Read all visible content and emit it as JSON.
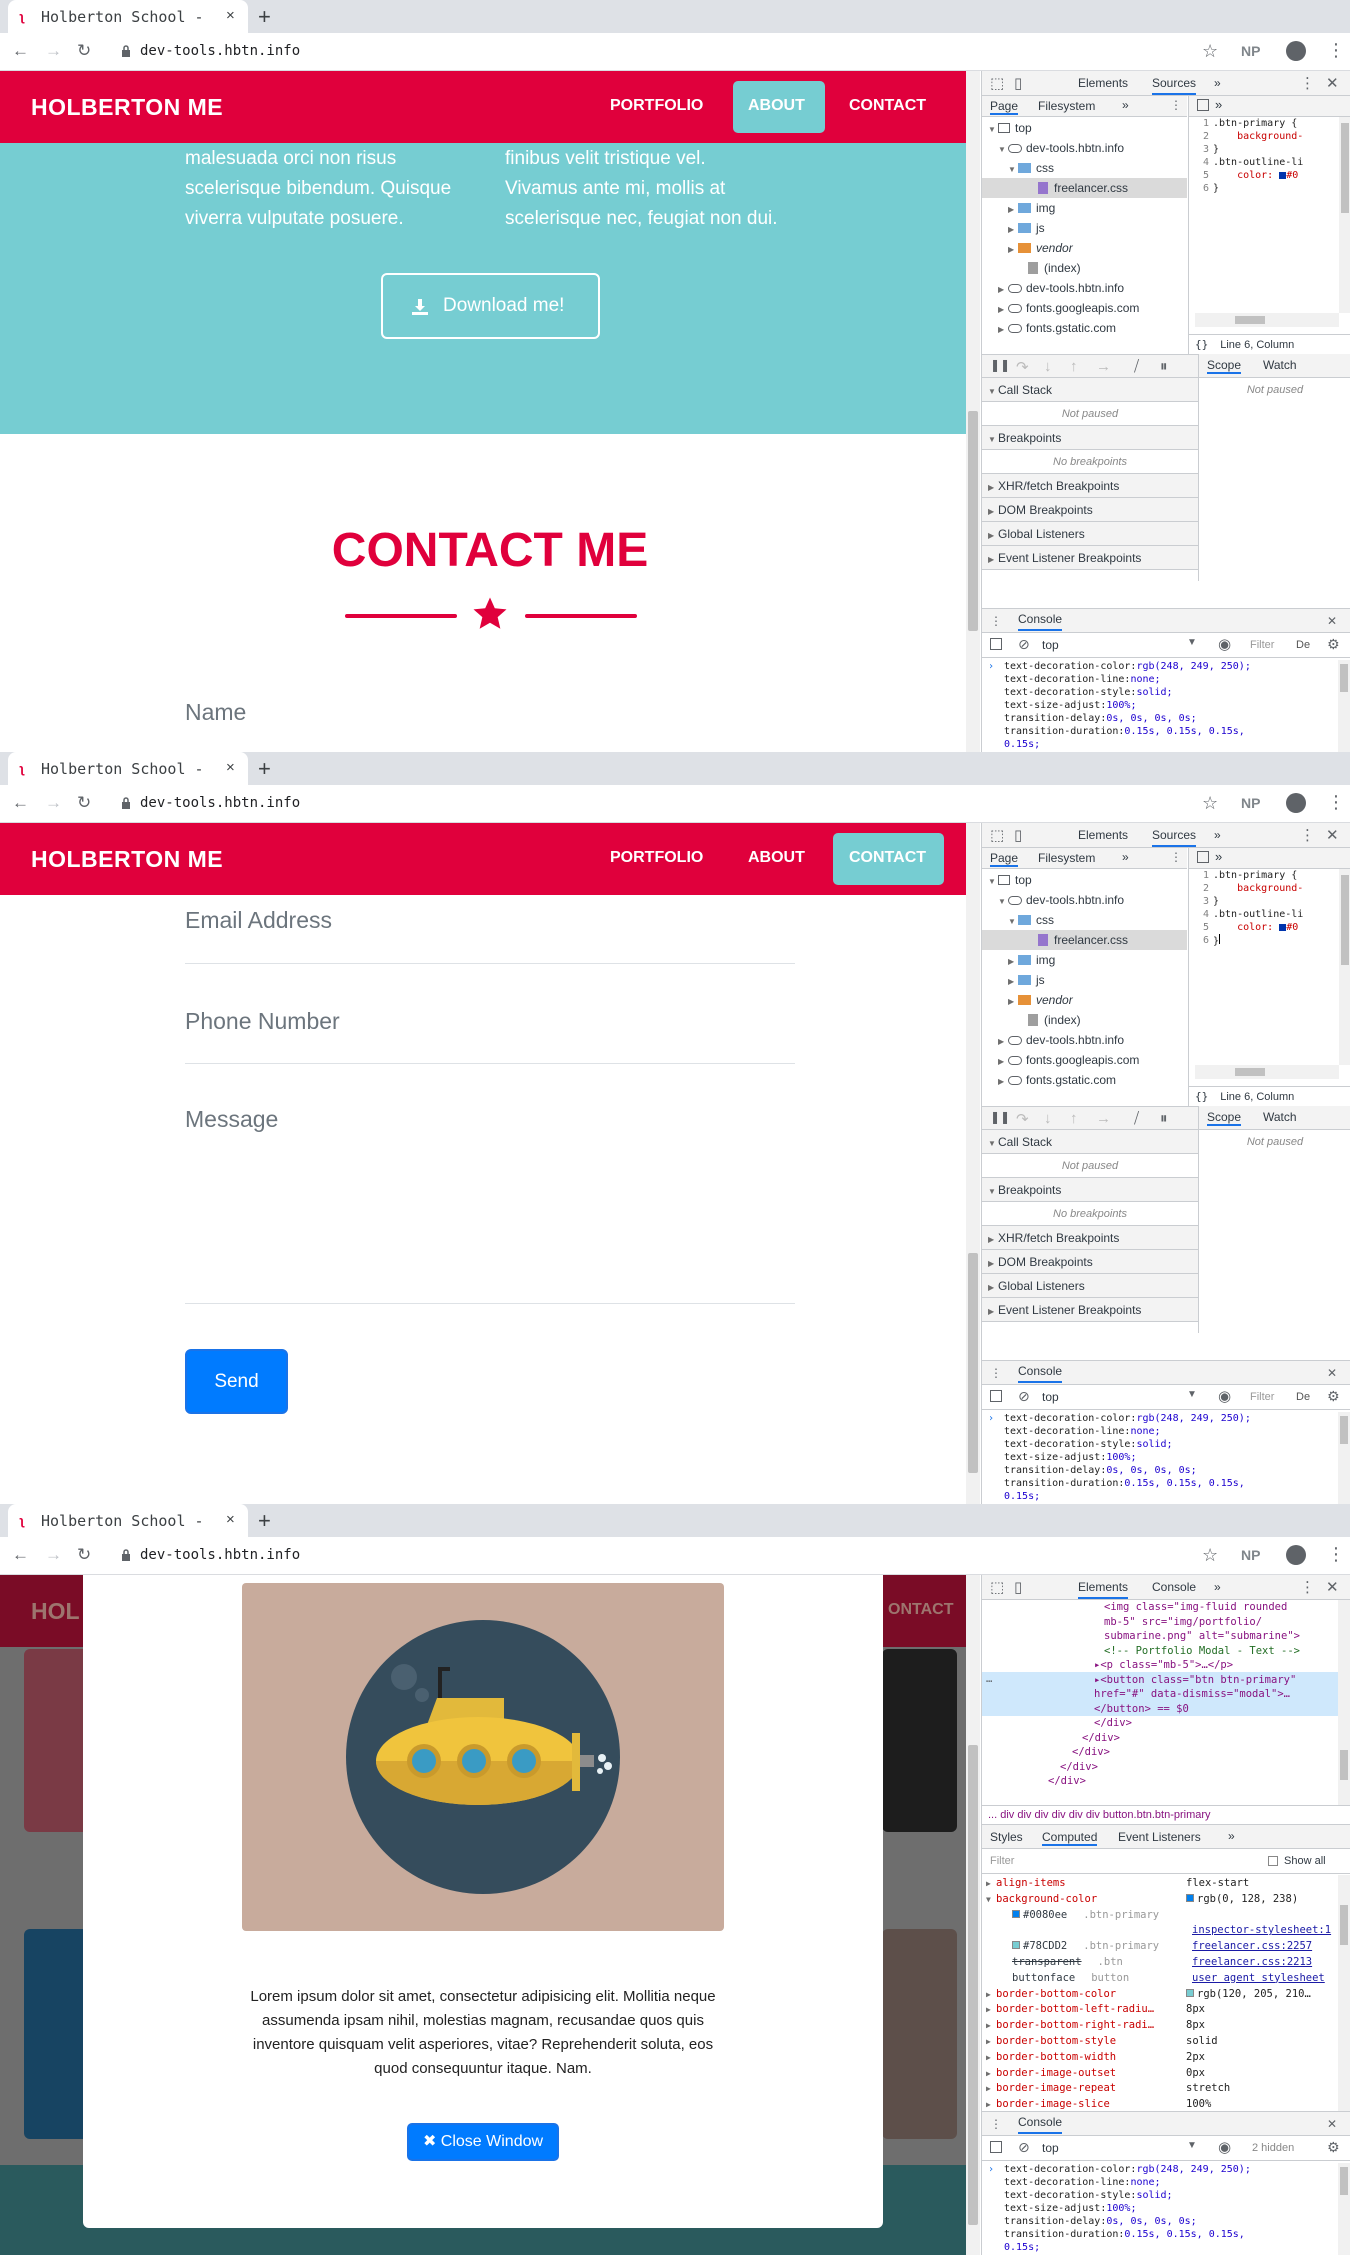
{
  "browser": {
    "tab_title": "Holberton School - ",
    "tab_close": "×",
    "new_tab": "+",
    "url": "dev-tools.hbtn.info",
    "extension_label": "NP"
  },
  "site": {
    "brand": "HOLBERTON ME",
    "nav": [
      "PORTFOLIO",
      "ABOUT",
      "CONTACT"
    ],
    "about_left_text": [
      "malesuada orci non risus",
      "scelerisque bibendum. Quisque",
      "viverra vulputate posuere."
    ],
    "about_right_text": [
      "finibus velit tristique vel.",
      "Vivamus ante mi, mollis at",
      "scelerisque nec, feugiat non dui."
    ],
    "download_label": "Download me!",
    "contact_title": "CONTACT ME",
    "fields": {
      "name": "Name",
      "email": "Email Address",
      "phone": "Phone Number",
      "message": "Message"
    },
    "send_label": "Send",
    "colors": {
      "primary": "#e0003c",
      "teal": "#76cdd2",
      "button_blue": "#007bff"
    }
  },
  "modal": {
    "text": "Lorem ipsum dolor sit amet, consectetur adipisicing elit. Mollitia neque assumenda ipsam nihil, molestias magnam, recusandae quos quis inventore quisquam velit asperiores, vitae? Reprehenderit soluta, eos quod consequuntur itaque. Nam.",
    "close_label": "Close Window",
    "partial_brand": "HOL",
    "partial_contact": "ONTACT"
  },
  "devtools": {
    "tabs": [
      "Elements",
      "Sources",
      "Console"
    ],
    "more": "»",
    "sources_subtabs": [
      "Page",
      "Filesystem"
    ],
    "tree": [
      "top",
      "dev-tools.hbtn.info",
      "css",
      "freelancer.css",
      "img",
      "js",
      "vendor",
      "(index)",
      "dev-tools.hbtn.info",
      "fonts.googleapis.com",
      "fonts.gstatic.com"
    ],
    "code_lines": [
      ".btn-primary {",
      "    background-",
      "}",
      ".btn-outline-li",
      "    color: ",
      "}"
    ],
    "line_numbers": [
      "1",
      "2",
      "3",
      "4",
      "5",
      "6"
    ],
    "code_color_text": "#0",
    "editor_status": "Line 6, Column",
    "debug_panes": [
      "Call Stack",
      "Breakpoints",
      "XHR/fetch Breakpoints",
      "DOM Breakpoints",
      "Global Listeners",
      "Event Listener Breakpoints"
    ],
    "not_paused": "Not paused",
    "no_breakpoints": "No breakpoints",
    "scope_tabs": [
      "Scope",
      "Watch"
    ],
    "console_title": "Console",
    "console_context": "top",
    "console_filter": "Filter",
    "console_levels": "De",
    "console_hidden": "2 hidden",
    "console_lines": [
      {
        "k": "text-decoration-color:",
        "v": "rgb(248, 249, 250);"
      },
      {
        "k": "text-decoration-line:",
        "v": "none;"
      },
      {
        "k": "text-decoration-style:",
        "v": "solid;"
      },
      {
        "k": "text-size-adjust:",
        "v": "100%;"
      },
      {
        "k": "transition-delay:",
        "v": "0s, 0s, 0s, 0s;"
      },
      {
        "k": "transition-duration:",
        "v": "0.15s, 0.15s, 0.15s,"
      },
      {
        "k": "",
        "v": "0.15s;"
      }
    ],
    "elements_html": [
      {
        "t": "tag",
        "s": "<img class=\"img-fluid rounded"
      },
      {
        "t": "tag",
        "s": "mb-5\" src=\"img/portfolio/"
      },
      {
        "t": "tag",
        "s": "submarine.png\" alt=\"submarine\">"
      },
      {
        "t": "cm",
        "s": "<!-- Portfolio Modal - Text -->"
      },
      {
        "t": "tag",
        "s": "▸<p class=\"mb-5\">…</p>"
      },
      {
        "t": "tag",
        "s": "▸<button class=\"btn btn-primary\""
      },
      {
        "t": "tag",
        "s": "href=\"#\" data-dismiss=\"modal\">…"
      },
      {
        "t": "tag",
        "s": "</button> == $0"
      },
      {
        "t": "tag",
        "s": "</div>"
      },
      {
        "t": "tag",
        "s": "</div>"
      },
      {
        "t": "tag",
        "s": "</div>"
      },
      {
        "t": "tag",
        "s": "</div>"
      },
      {
        "t": "tag",
        "s": "</div>"
      }
    ],
    "breadcrumbs": "...  div  div  div  div  div  div  button.btn.btn-primary",
    "styles_tabs": [
      "Styles",
      "Computed",
      "Event Listeners"
    ],
    "computed_filter": "Filter",
    "show_all": "Show all",
    "computed": [
      {
        "p": "align-items",
        "v": "flex-start"
      },
      {
        "p": "background-color",
        "v": "rgb(0, 128, 238)",
        "sw": "#0080ee"
      },
      {
        "p": "",
        "sub": "#0080ee",
        "sel": ".btn-primary",
        "src": "",
        "sw": "#0080ee"
      },
      {
        "p": "",
        "sub": "",
        "sel": "",
        "src": "inspector-stylesheet:1"
      },
      {
        "p": "",
        "sub": "#78CDD2",
        "sel": ".btn-primary",
        "src": "freelancer.css:2257",
        "sw": "#78cdd2"
      },
      {
        "p": "",
        "sub": "transparent",
        "sel": ".btn",
        "src": "freelancer.css:2213"
      },
      {
        "p": "",
        "sub": "buttonface",
        "sel": "button",
        "src": "user agent stylesheet"
      },
      {
        "p": "border-bottom-color",
        "v": "rgb(120, 205, 210…",
        "sw": "#78cdd2"
      },
      {
        "p": "border-bottom-left-radiu…",
        "v": "8px"
      },
      {
        "p": "border-bottom-right-radi…",
        "v": "8px"
      },
      {
        "p": "border-bottom-style",
        "v": "solid"
      },
      {
        "p": "border-bottom-width",
        "v": "2px"
      },
      {
        "p": "border-image-outset",
        "v": "0px"
      },
      {
        "p": "border-image-repeat",
        "v": "stretch"
      },
      {
        "p": "border-image-slice",
        "v": "100%"
      }
    ]
  }
}
